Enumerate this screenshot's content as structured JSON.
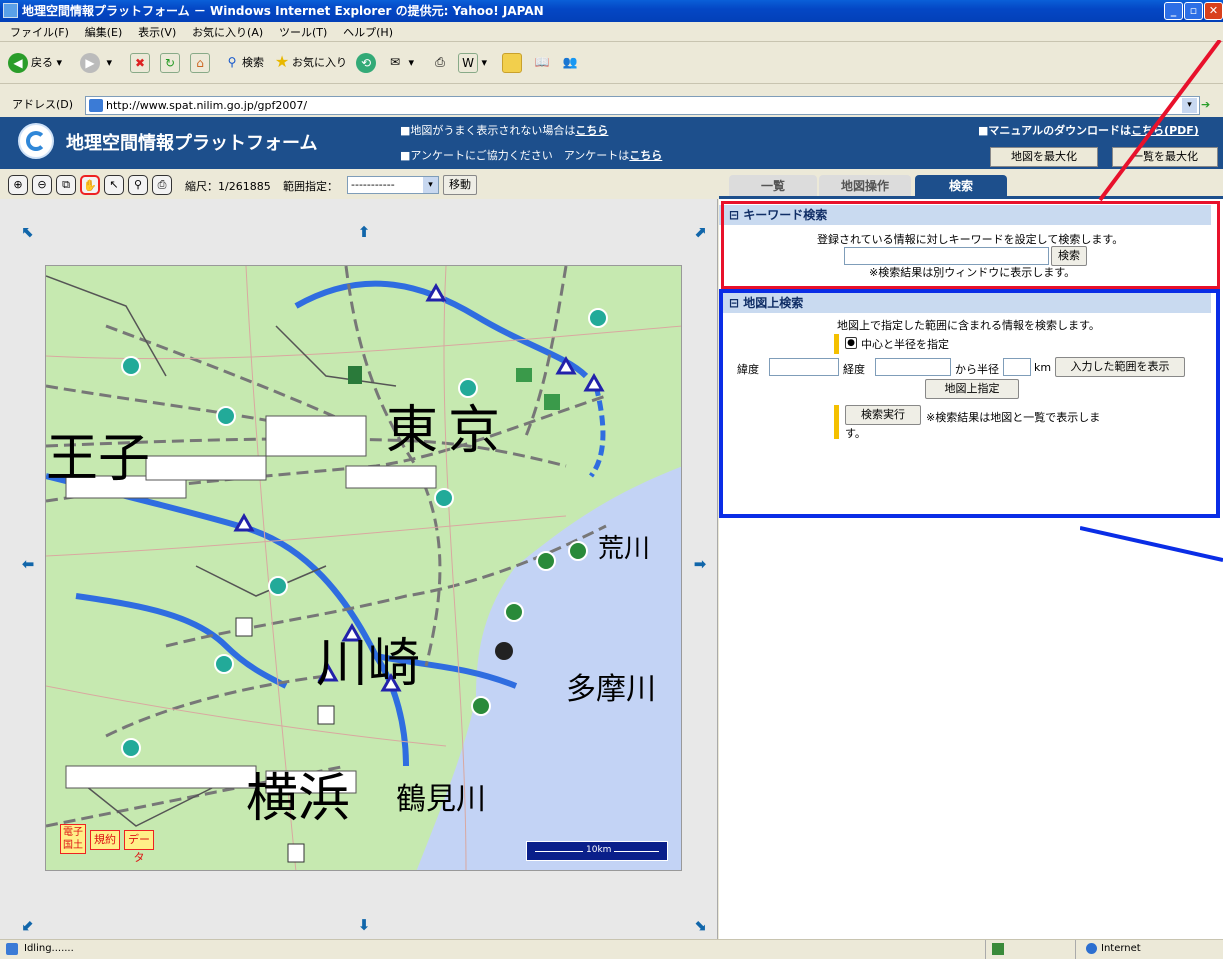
{
  "window": {
    "title": "地理空間情報プラットフォーム － Windows Internet Explorer の提供元: Yahoo! JAPAN"
  },
  "menu": [
    "ファイル(F)",
    "編集(E)",
    "表示(V)",
    "お気に入り(A)",
    "ツール(T)",
    "ヘルプ(H)"
  ],
  "toolbar": {
    "back": "戻る",
    "search": "検索",
    "favorites": "お気に入り"
  },
  "address": {
    "label": "アドレス(D)",
    "url": "http://www.spat.nilim.go.jp/gpf2007/",
    "go": "移動"
  },
  "header": {
    "title": "地理空間情報プラットフォーム",
    "note1": "■地図がうまく表示されない場合は",
    "note1_link": "こちら",
    "note2": "■アンケートにご協力ください　アンケートは",
    "note2_link": "こちら",
    "manual": "■マニュアルのダウンロードは",
    "manual_link": "こちら(PDF)",
    "maximize_map": "地図を最大化",
    "maximize_list": "一覧を最大化"
  },
  "maptools": {
    "scale": "縮尺：1/261885",
    "range_label": "範囲指定：",
    "range_value": "-----------",
    "move": "移動"
  },
  "map": {
    "labels": {
      "hachioji": "王子",
      "tokyo": "東京",
      "arakawa": "荒川",
      "kawasaki": "川崎",
      "tamagawa": "多摩川",
      "yokohama": "横浜",
      "tsurumi": "鶴見川"
    },
    "scalebar": "10km",
    "badges": [
      "電子国土",
      "規約",
      "データ"
    ]
  },
  "tabs": [
    "一覧",
    "地図操作",
    "検索"
  ],
  "keyword": {
    "head": "キーワード検索",
    "desc": "登録されている情報に対しキーワードを設定して検索します。",
    "button": "検索",
    "note": "※検索結果は別ウィンドウに表示します。"
  },
  "mapsearch": {
    "head": "地図上検索",
    "desc": "地図上で指定した範囲に含まれる情報を検索します。",
    "radio": "中心と半径を指定",
    "lat": "緯度",
    "lon": "経度",
    "radius_prefix": "から半径",
    "km": "km",
    "show_range": "入力した範囲を表示",
    "map_specify": "地図上指定",
    "execute": "検索実行",
    "result_note": "※検索結果は地図と一覧で表示しま",
    "result_note2": "す。"
  },
  "status": {
    "text": "Idling.......",
    "zone": "Internet"
  },
  "colors": {
    "header": "#1d4f8c",
    "map_land": "#c6e9b0",
    "map_water": "#c3d3f5",
    "red_box": "#e8112b",
    "blue_box": "#0a2de6"
  }
}
